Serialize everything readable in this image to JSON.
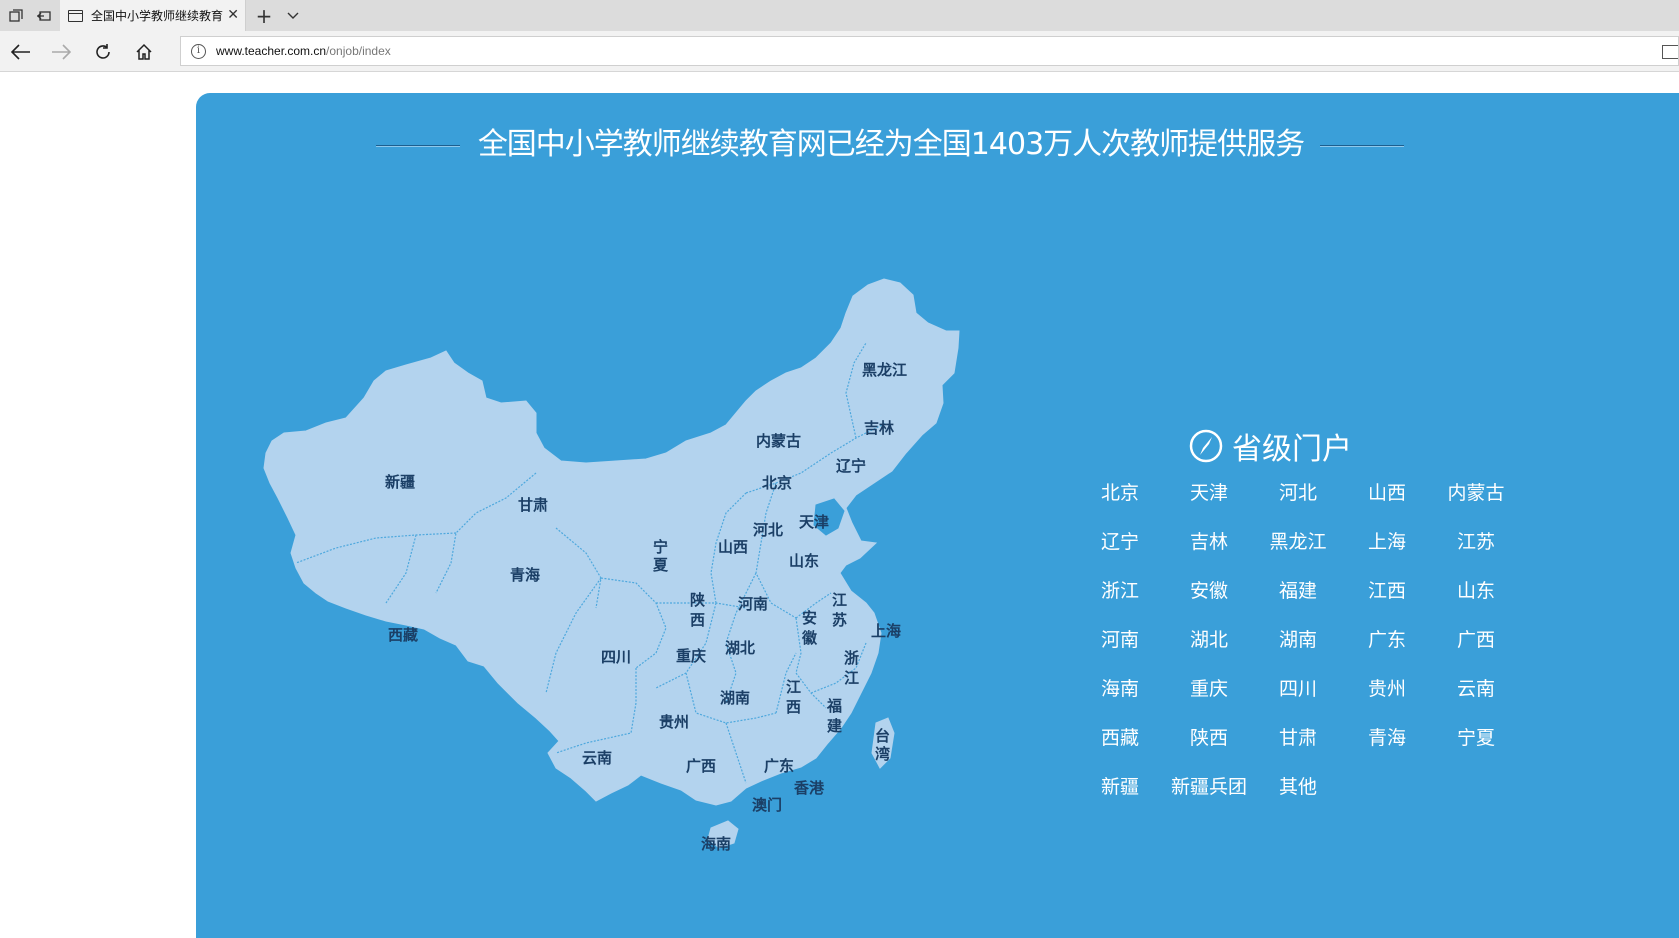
{
  "browser": {
    "tab_title": "全国中小学教师继续教育",
    "url_host": "www.teacher.com.cn",
    "url_path": "/onjob/index"
  },
  "page": {
    "headline": "全国中小学教师继续教育网已经为全国1403万人次教师提供服务",
    "portal_title": "省级门户",
    "provinces": [
      "北京",
      "天津",
      "河北",
      "山西",
      "内蒙古",
      "辽宁",
      "吉林",
      "黑龙江",
      "上海",
      "江苏",
      "浙江",
      "安徽",
      "福建",
      "江西",
      "山东",
      "河南",
      "湖北",
      "湖南",
      "广东",
      "广西",
      "海南",
      "重庆",
      "四川",
      "贵州",
      "云南",
      "西藏",
      "陕西",
      "甘肃",
      "青海",
      "宁夏",
      "新疆",
      "新疆兵团",
      "其他"
    ],
    "map_labels": {
      "heilongjiang": "黑龙江",
      "jilin": "吉林",
      "liaoning": "辽宁",
      "neimenggu": "内蒙古",
      "beijing": "北京",
      "tianjin": "天津",
      "hebei": "河北",
      "shanxi": "山西",
      "shandong": "山东",
      "ningxia_1": "宁",
      "ningxia_2": "夏",
      "gansu": "甘肃",
      "xinjiang": "新疆",
      "qinghai": "青海",
      "xizang": "西藏",
      "shaanxi_1": "陕",
      "shaanxi_2": "西",
      "henan": "河南",
      "jiangsu_1": "江",
      "jiangsu_2": "苏",
      "anhui_1": "安",
      "anhui_2": "徽",
      "shanghai": "上海",
      "hubei": "湖北",
      "sichuan": "四川",
      "chongqing": "重庆",
      "zhejiang_1": "浙",
      "zhejiang_2": "江",
      "jiangxi_1": "江",
      "jiangxi_2": "西",
      "hunan": "湖南",
      "fujian_1": "福",
      "fujian_2": "建",
      "guizhou": "贵州",
      "taiwan_1": "台",
      "taiwan_2": "湾",
      "yunnan": "云南",
      "guangxi": "广西",
      "guangdong": "广东",
      "xianggang": "香港",
      "aomen": "澳门",
      "hainan": "海南"
    },
    "colors": {
      "background": "#3a9fd9",
      "map_fill": "#b3d3ee",
      "map_label": "#1b3f66"
    },
    "icons": {
      "portal": "compass-icon"
    }
  }
}
